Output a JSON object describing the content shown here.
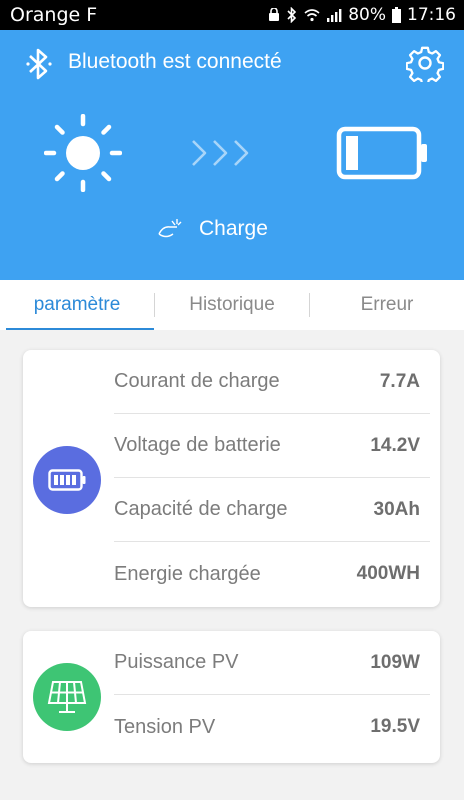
{
  "status_bar": {
    "carrier": "Orange F",
    "battery_percent": "80%",
    "time": "17:16"
  },
  "header": {
    "bluetooth_text": "Bluetooth est connecté",
    "mode_text": "Charge",
    "background_color": "#3ea2f2"
  },
  "tabs": [
    {
      "label": "paramètre",
      "active": true
    },
    {
      "label": "Historique",
      "active": false
    },
    {
      "label": "Erreur",
      "active": false
    }
  ],
  "battery_card": {
    "icon": "battery-icon",
    "icon_color": "#5a6de0",
    "rows": [
      {
        "label": "Courant de charge",
        "value": "7.7A"
      },
      {
        "label": "Voltage de batterie",
        "value": "14.2V"
      },
      {
        "label": "Capacité de charge",
        "value": "30Ah"
      },
      {
        "label": "Energie chargée",
        "value": "400WH"
      }
    ]
  },
  "pv_card": {
    "icon": "solar-panel-icon",
    "icon_color": "#3ec574",
    "rows": [
      {
        "label": "Puissance PV",
        "value": "109W"
      },
      {
        "label": "Tension PV",
        "value": "19.5V"
      }
    ]
  }
}
